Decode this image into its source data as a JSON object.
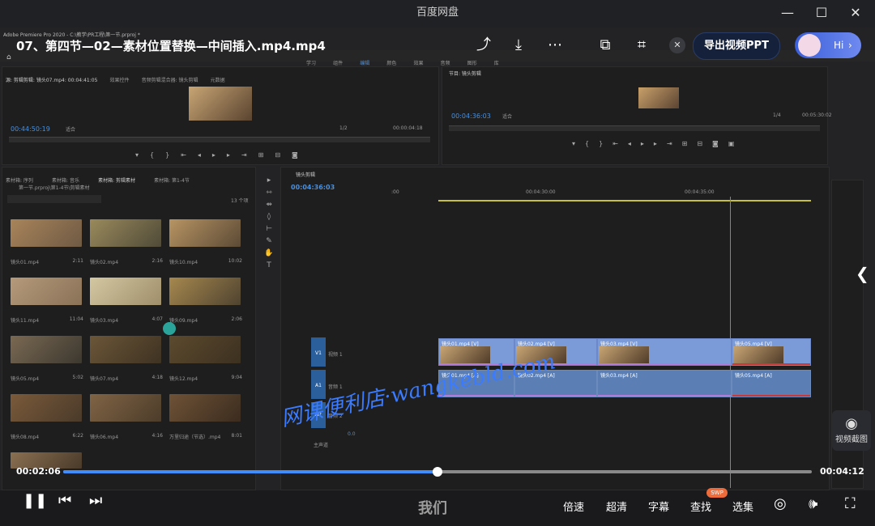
{
  "window": {
    "title": "百度网盘",
    "minimize_icon": "—",
    "maximize_icon": "☐",
    "close_icon": "✕"
  },
  "video": {
    "title": "07、第四节—02—素材位置替换—中间插入.mp4.mp4",
    "export_ppt_label": "导出视频PPT",
    "assistant_label": "Hi",
    "screenshot_label": "视频截图",
    "watermark": "网课便利店·wangkebld.com",
    "subtitle": "我们",
    "elapsed": "00:02:06",
    "duration": "00:04:12",
    "progress": 0.5
  },
  "controls": {
    "speed": "倍速",
    "quality": "超清",
    "captions": "字幕",
    "search": "查找",
    "search_badge": "SWP",
    "episodes": "选集"
  },
  "premiere": {
    "app_name": "Adobe Premiere Pro 2020 - C:\\教学\\PR工程\\第一节.prproj *",
    "workspace_tabs": [
      "学习",
      "组件",
      "编辑",
      "颜色",
      "效果",
      "音频",
      "图形",
      "库"
    ],
    "source_tabs": [
      "源: 剪辑剪辑: 镜头07.mp4: 00:04:41:05",
      "效果控件",
      "音频剪辑混合器: 镜头剪辑",
      "元数据"
    ],
    "source_tc_left": "00:44:50:19",
    "source_fit": "适合",
    "source_ratio": "1/2",
    "source_tc_right": "00:00:04:18",
    "program_tab": "节目: 镜头剪辑",
    "program_tc_left": "00:04:36:03",
    "program_fit": "适合",
    "program_ratio": "1/4",
    "program_tc_right": "00:05:30:02",
    "project_tabs": [
      "素材箱: 序列",
      "素材箱: 音乐",
      "素材箱: 剪辑素材",
      "素材箱: 第1-4节"
    ],
    "project_path": "第一节.prproj\\第1-4节\\剪辑素材",
    "item_count": "13 个项",
    "media": [
      {
        "name": "镜头01.mp4",
        "dur": "2:11",
        "c1": "#a8845a",
        "c2": "#6f5a44"
      },
      {
        "name": "镜头02.mp4",
        "dur": "2:16",
        "c1": "#9a8a5c",
        "c2": "#4f4a38"
      },
      {
        "name": "镜头10.mp4",
        "dur": "10:02",
        "c1": "#b79463",
        "c2": "#5c4a36"
      },
      {
        "name": "镜头11.mp4",
        "dur": "11:04",
        "c1": "#b59a7a",
        "c2": "#8a7258"
      },
      {
        "name": "镜头03.mp4",
        "dur": "4:07",
        "c1": "#d3c7a2",
        "c2": "#9f8f6a"
      },
      {
        "name": "镜头09.mp4",
        "dur": "2:06",
        "c1": "#a6884e",
        "c2": "#4f4330"
      },
      {
        "name": "镜头05.mp4",
        "dur": "5:02",
        "c1": "#7a6952",
        "c2": "#3c3830"
      },
      {
        "name": "镜头07.mp4",
        "dur": "4:18",
        "c1": "#6b5638",
        "c2": "#3e3222"
      },
      {
        "name": "镜头12.mp4",
        "dur": "9:04",
        "c1": "#5c4a2e",
        "c2": "#3c3020"
      },
      {
        "name": "镜头08.mp4",
        "dur": "6:22",
        "c1": "#7a5a3a",
        "c2": "#4a3a2a"
      },
      {
        "name": "镜头06.mp4",
        "dur": "4:16",
        "c1": "#806445",
        "c2": "#4c3c2a"
      },
      {
        "name": "万里归途（节选）.mp4",
        "dur": "8:01",
        "c1": "#6e5236",
        "c2": "#3b2c1f"
      }
    ],
    "timeline_tab": "镜头剪辑",
    "timeline_tc": "00:04:36:03",
    "ruler": [
      ":00",
      "00:04:30:00",
      "00:04:35:00"
    ],
    "tracks": [
      {
        "name": "V1",
        "label": "视频 1"
      },
      {
        "name": "A1",
        "label": "音频 1"
      },
      {
        "name": "A2",
        "label": "音频 2"
      },
      {
        "name": "master",
        "label": "主声道",
        "value": "0.0"
      }
    ],
    "video_clips": [
      "镜头01.mp4 [V]",
      "镜头02.mp4 [V]",
      "镜头03.mp4 [V]",
      "镜头05.mp4 [V]"
    ],
    "audio_clips": [
      "镜头01.mp4 [A]",
      "镜头02.mp4 [A]",
      "镜头03.mp4 [A]",
      "镜头05.mp4 [A]"
    ]
  },
  "colors": {
    "accent": "#3f8dff",
    "premiere_blue": "#4d8fd8",
    "track_blue": "#7b9bd8"
  }
}
